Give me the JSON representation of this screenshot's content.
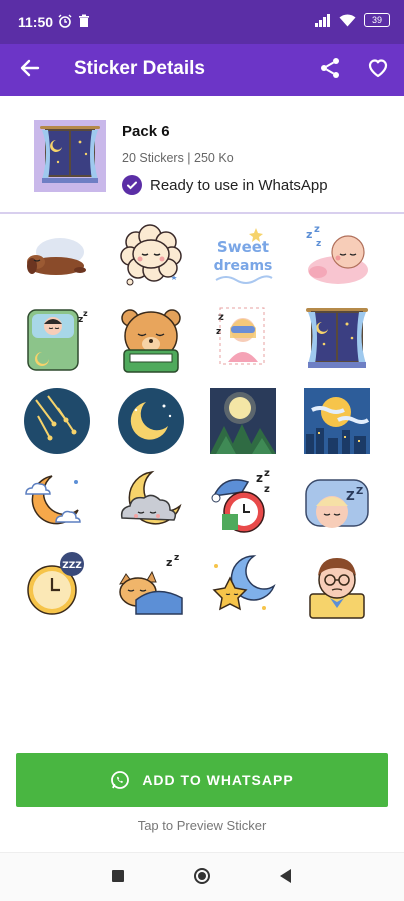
{
  "status_bar": {
    "time": "11:50",
    "battery": "39"
  },
  "app_bar": {
    "title": "Sticker Details"
  },
  "pack": {
    "name": "Pack 6",
    "meta": "20 Stickers | 250 Ko",
    "status": "Ready to use in WhatsApp"
  },
  "stickers": [
    {
      "name": "sleeping-dog"
    },
    {
      "name": "sleeping-sheep-cloud"
    },
    {
      "name": "sweet-dreams-text",
      "text1": "Sweet",
      "text2": "dreams"
    },
    {
      "name": "sleeping-baby"
    },
    {
      "name": "girl-in-bed"
    },
    {
      "name": "bear-in-bed"
    },
    {
      "name": "girl-sleep-mask"
    },
    {
      "name": "night-window"
    },
    {
      "name": "shooting-stars"
    },
    {
      "name": "crescent-moon-circle"
    },
    {
      "name": "moon-forest"
    },
    {
      "name": "full-moon-city"
    },
    {
      "name": "moon-clouds"
    },
    {
      "name": "sleeping-cloud"
    },
    {
      "name": "alarm-clock-nightcap"
    },
    {
      "name": "sleeping-face-pillow"
    },
    {
      "name": "zzz-clock"
    },
    {
      "name": "sleeping-cat"
    },
    {
      "name": "star-moon"
    },
    {
      "name": "tired-man"
    }
  ],
  "actions": {
    "add_label": "ADD TO WHATSAPP",
    "hint": "Tap to Preview Sticker"
  },
  "colors": {
    "status_bar": "#5b2ea6",
    "app_bar": "#6c35c7",
    "add_button": "#49b641"
  }
}
